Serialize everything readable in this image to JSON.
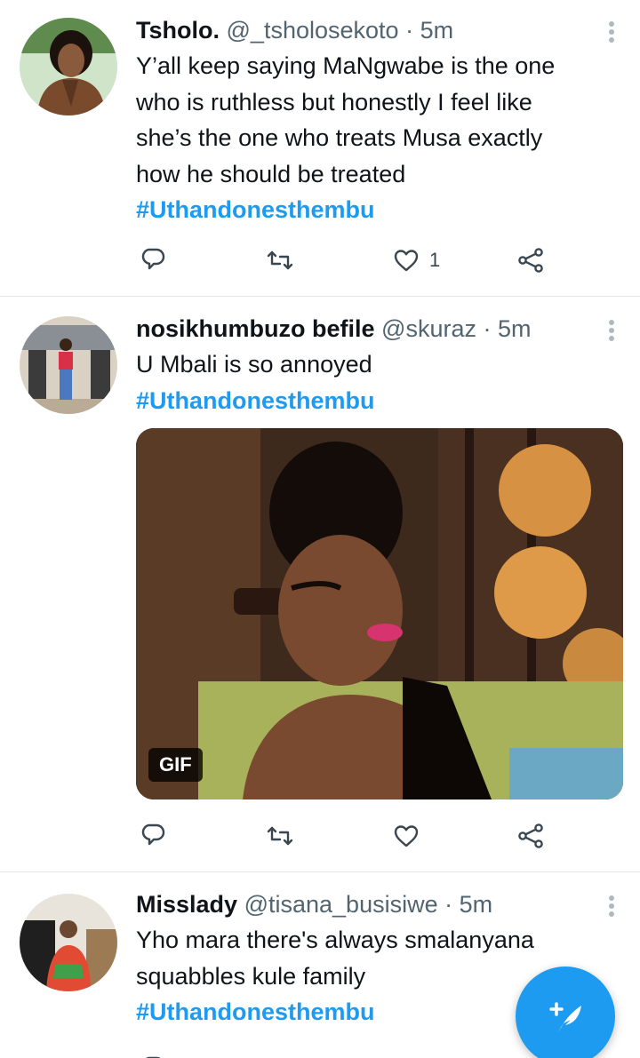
{
  "colors": {
    "accent": "#1d9bf0",
    "text": "#0f1419",
    "muted": "#536471",
    "divider": "#e3e6e8"
  },
  "tweets": [
    {
      "name": "Tsholo.",
      "handle": "@_tsholosekoto",
      "separator": "·",
      "time": "5m",
      "lines": [
        "Y’all keep saying MaNgwabe is the one",
        "who is ruthless but honestly I feel like",
        "she’s the one who treats Musa exactly",
        "how he should be treated"
      ],
      "hashtag": "#Uthandonesthembu",
      "like_count": "1",
      "icons": [
        "reply-icon",
        "retweet-icon",
        "heart-icon",
        "share-icon"
      ]
    },
    {
      "name": "nosikhumbuzo befile",
      "handle": "@skuraz",
      "separator": "·",
      "time": "5m",
      "lines": [
        "U Mbali is so annoyed"
      ],
      "hashtag": "#Uthandonesthembu",
      "media_badge": "GIF",
      "icons": [
        "reply-icon",
        "retweet-icon",
        "heart-icon",
        "share-icon"
      ]
    },
    {
      "name": "Misslady",
      "handle": "@tisana_busisiwe",
      "separator": "·",
      "time": "5m",
      "lines": [
        "Yho mara there's always smalanyana",
        "squabbles kule family"
      ],
      "hashtag": "#Uthandonesthembu"
    }
  ],
  "compose": {
    "icon": "compose-feather-icon"
  }
}
